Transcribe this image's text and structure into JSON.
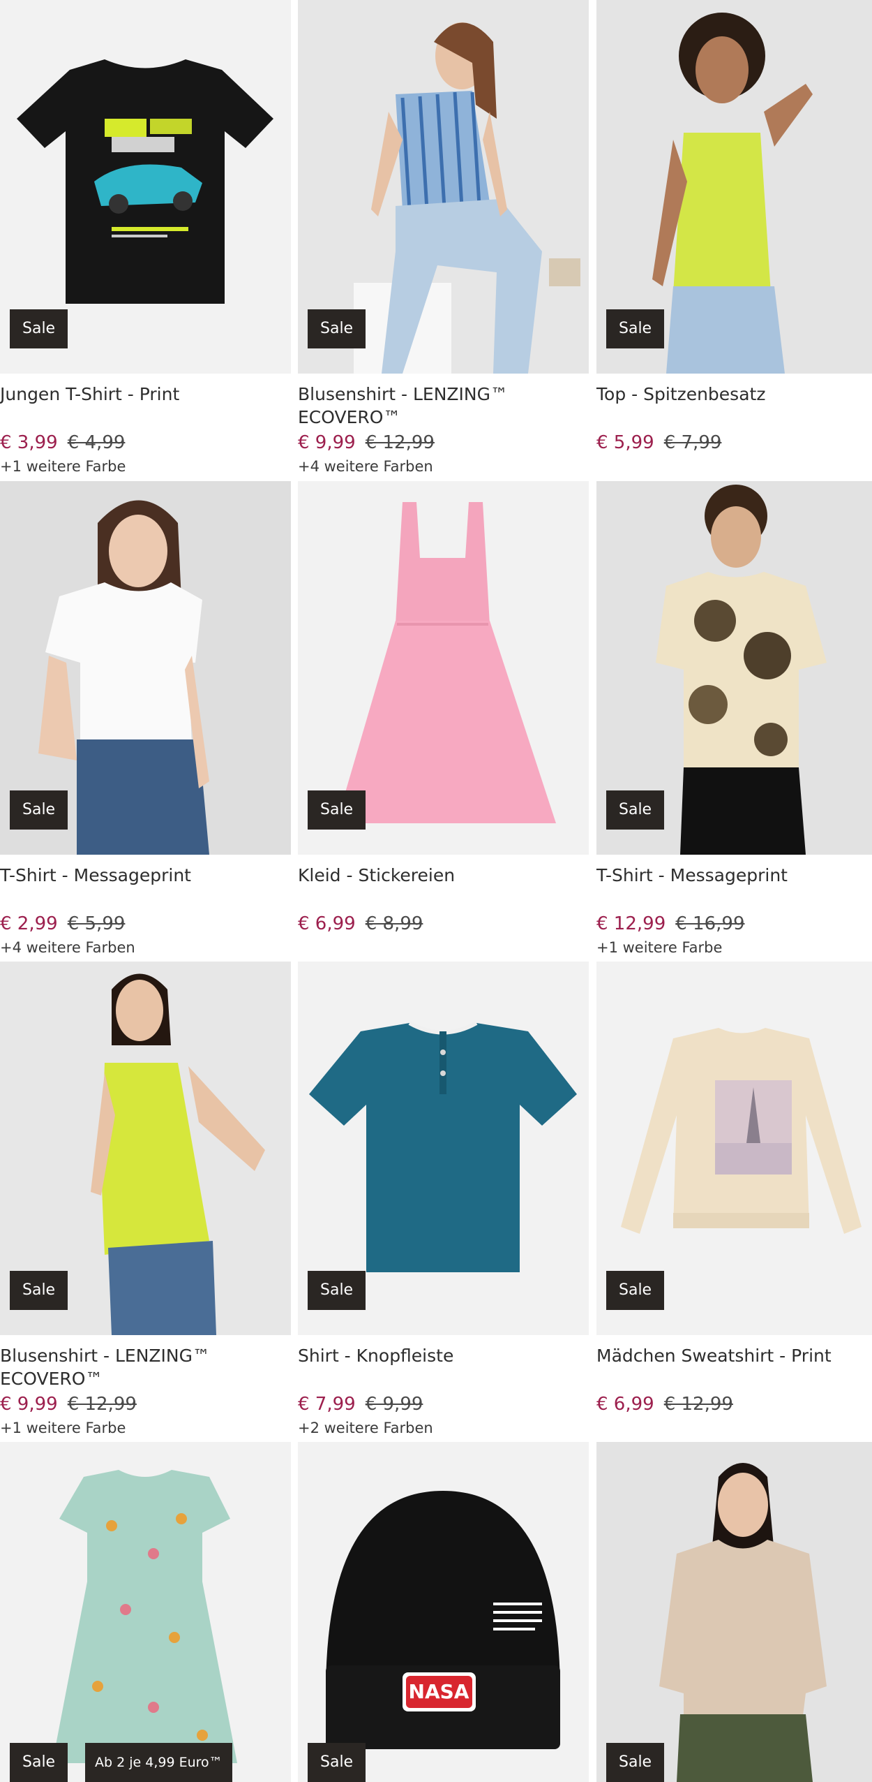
{
  "products": [
    {
      "title": "Jungen T-Shirt - Print",
      "price": "€ 3,99",
      "old_price": "€ 4,99",
      "colors": "+1 weitere Farbe",
      "badge": "Sale",
      "image": "black-car-tshirt"
    },
    {
      "title": "Blusenshirt - LENZING™ ECOVERO™",
      "price": "€ 9,99",
      "old_price": "€ 12,99",
      "colors": "+4 weitere Farben",
      "badge": "Sale",
      "image": "striped-blouse-model"
    },
    {
      "title": "Top - Spitzenbesatz",
      "price": "€ 5,99",
      "old_price": "€ 7,99",
      "colors": "",
      "badge": "Sale",
      "image": "lime-top-model"
    },
    {
      "title": "T-Shirt - Messageprint",
      "price": "€ 2,99",
      "old_price": "€ 5,99",
      "colors": "+4 weitere Farben",
      "badge": "Sale",
      "image": "white-tshirt-model"
    },
    {
      "title": "Kleid - Stickereien",
      "price": "€ 6,99",
      "old_price": "€ 8,99",
      "colors": "",
      "badge": "Sale",
      "image": "pink-dress"
    },
    {
      "title": "T-Shirt - Messageprint",
      "price": "€ 12,99",
      "old_price": "€ 16,99",
      "colors": "+1 weitere Farbe",
      "badge": "Sale",
      "image": "tiedye-tshirt-model"
    },
    {
      "title": "Blusenshirt - LENZING™ ECOVERO™",
      "price": "€ 9,99",
      "old_price": "€ 12,99",
      "colors": "+1 weitere Farbe",
      "badge": "Sale",
      "image": "lime-blouse-model"
    },
    {
      "title": "Shirt - Knopfleiste",
      "price": "€ 7,99",
      "old_price": "€ 9,99",
      "colors": "+2 weitere Farben",
      "badge": "Sale",
      "image": "teal-henley-shirt"
    },
    {
      "title": "Mädchen Sweatshirt - Print",
      "price": "€ 6,99",
      "old_price": "€ 12,99",
      "colors": "",
      "badge": "Sale",
      "image": "beige-sweatshirt"
    },
    {
      "title": "",
      "price": "",
      "old_price": "",
      "colors": "",
      "badge": "Sale",
      "offer_badge": "Ab 2 je 4,99 Euro™",
      "image": "mint-print-dress"
    },
    {
      "title": "",
      "price": "",
      "old_price": "",
      "colors": "",
      "badge": "Sale",
      "image": "nasa-beanie",
      "print": "NASA"
    },
    {
      "title": "",
      "price": "",
      "old_price": "",
      "colors": "",
      "badge": "Sale",
      "image": "satin-blouse-model"
    }
  ],
  "colors": {
    "sale_price": "#9c1f4d",
    "badge_bg": "#2a2623",
    "image_bg": "#ebebeb"
  }
}
